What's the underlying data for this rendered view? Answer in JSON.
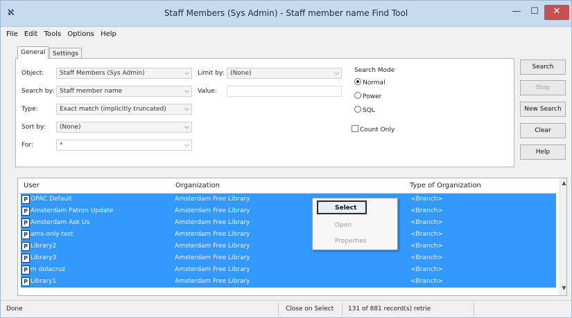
{
  "window": {
    "title": "Staff Members (Sys Admin) - Staff member name Find Tool",
    "app_icon": "app-icon",
    "minimize_glyph": "—",
    "maximize_glyph": "☐",
    "close_glyph": "✕"
  },
  "menu": [
    "File",
    "Edit",
    "Tools",
    "Options",
    "Help"
  ],
  "tabs": {
    "general": "General",
    "settings": "Settings"
  },
  "form": {
    "object": {
      "label": "Object:",
      "value": "Staff Members (Sys Admin)"
    },
    "search_by": {
      "label": "Search by:",
      "value": "Staff member name"
    },
    "type": {
      "label": "Type:",
      "value": "Exact match (implicitly truncated)"
    },
    "sort_by": {
      "label": "Sort by:",
      "value": "(None)"
    },
    "for": {
      "label": "For:",
      "value": "*"
    },
    "limit_by": {
      "label": "Limit by:",
      "value": "(None)"
    },
    "value": {
      "label": "Value:",
      "value": ""
    }
  },
  "search_mode": {
    "title": "Search Mode",
    "options": [
      {
        "label": "Normal",
        "selected": true
      },
      {
        "label": "Power",
        "selected": false
      },
      {
        "label": "SQL",
        "selected": false
      }
    ]
  },
  "count_only": {
    "label": "Count Only",
    "checked": false
  },
  "buttons": {
    "search": "Search",
    "stop": "Stop",
    "new_search": "New Search",
    "clear": "Clear",
    "help": "Help"
  },
  "results": {
    "columns": [
      "User",
      "Organization",
      "Type of Organization"
    ],
    "rows": [
      {
        "user": "OPAC Default",
        "organization": "Amsterdam Free Library",
        "type": "<Branch>"
      },
      {
        "user": "Amsterdam Patron Update",
        "organization": "Amsterdam Free Library",
        "type": "<Branch>"
      },
      {
        "user": "Amsterdam Ask Us",
        "organization": "Amsterdam Free Library",
        "type": "<Branch>"
      },
      {
        "user": "ams-only-test",
        "organization": "Amsterdam Free Library",
        "type": "<Branch>"
      },
      {
        "user": "Library2",
        "organization": "Amsterdam Free Library",
        "type": "<Branch>"
      },
      {
        "user": "Library3",
        "organization": "Amsterdam Free Library",
        "type": "<Branch>"
      },
      {
        "user": "m dolacruz",
        "organization": "Amsterdam Free Library",
        "type": "<Branch>"
      },
      {
        "user": "Library1",
        "organization": "Amsterdam Free Library",
        "type": "<Branch>"
      }
    ],
    "selection_color": "#3399ff"
  },
  "context_menu": {
    "select": "Select",
    "open": "Open",
    "properties": "Properties"
  },
  "status": {
    "state": "Done",
    "close_on_select": "Close on Select",
    "count": "131 of 881 record(s) retrie"
  }
}
